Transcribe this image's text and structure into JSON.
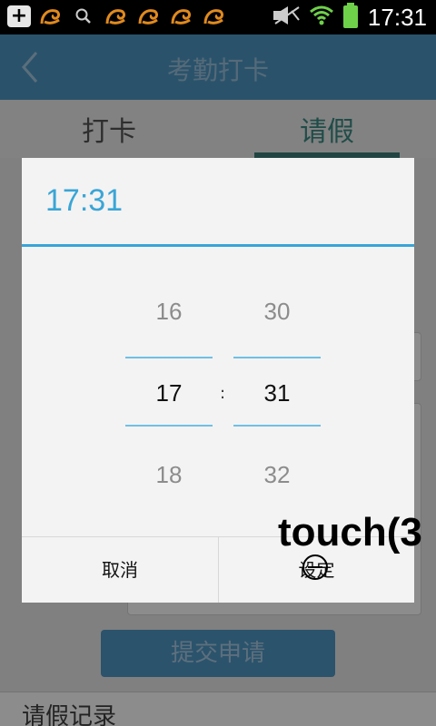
{
  "status_bar": {
    "time": "17:31",
    "icons": [
      "add-icon",
      "uc-squirrel-icon",
      "search-icon",
      "uc-squirrel-icon",
      "uc-squirrel-icon",
      "uc-squirrel-icon",
      "uc-squirrel-icon",
      "mute-icon",
      "wifi-icon",
      "battery-icon"
    ]
  },
  "header": {
    "title": "考勤打卡"
  },
  "tabs": [
    {
      "label": "打卡",
      "active": false
    },
    {
      "label": "请假",
      "active": true
    }
  ],
  "form": {
    "submit_label": "提交申请",
    "records_label": "请假记录"
  },
  "dialog": {
    "title_time": "17:31",
    "hours": {
      "prev": "16",
      "selected": "17",
      "next": "18"
    },
    "minutes": {
      "prev": "30",
      "selected": "31",
      "next": "32"
    },
    "separator": ":",
    "cancel_label": "取消",
    "set_label": "设定"
  },
  "touch_overlay": {
    "text": "touch(3"
  },
  "colors": {
    "title_bar": "#4d97c4",
    "accent": "#38a5d8",
    "tab_active": "#3b8a83"
  }
}
